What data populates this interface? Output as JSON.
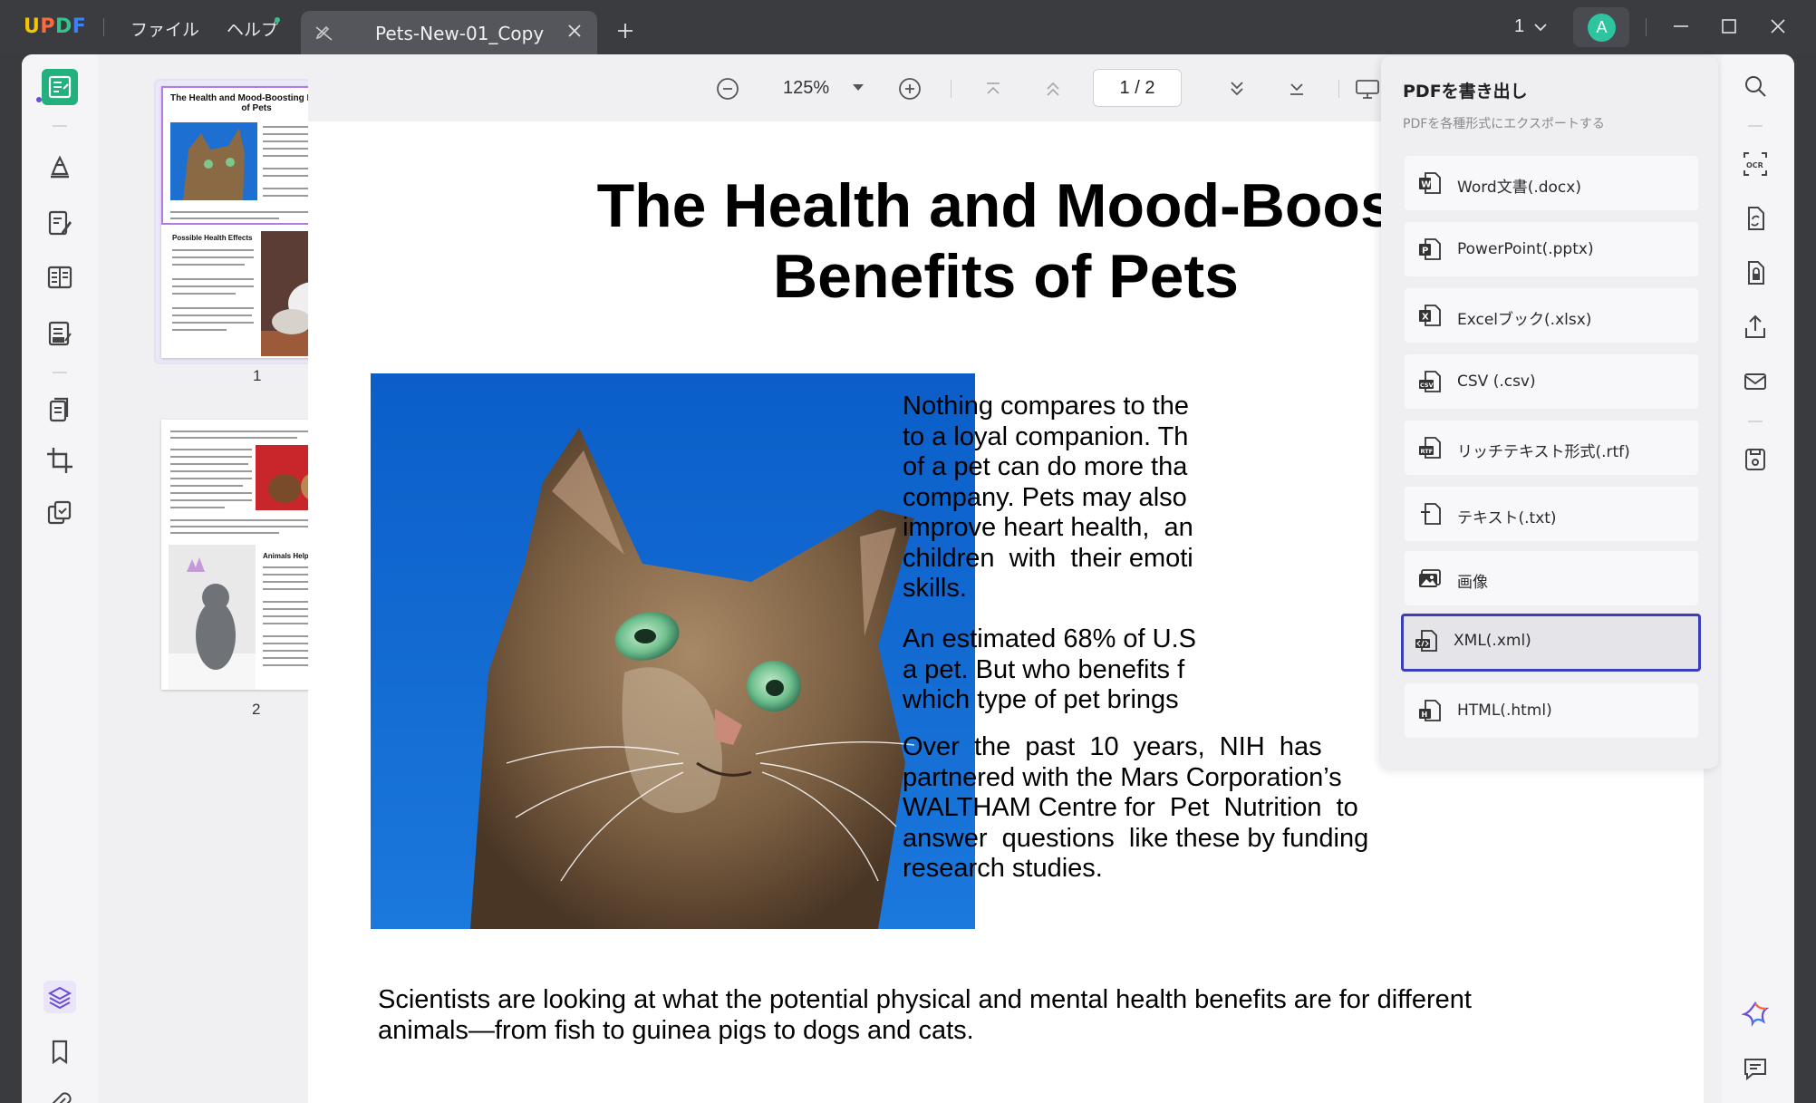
{
  "app": {
    "logo": "UPDF",
    "menus": [
      "ファイル",
      "ヘルプ"
    ],
    "tab_title": "Pets-New-01_Copy",
    "page_selector": "1",
    "avatar_letter": "A",
    "brand_colors": {
      "accent": "#22b07d",
      "selection": "#3b3dbf",
      "highlight": "#b27be8"
    }
  },
  "toolbar": {
    "zoom": "125%",
    "page_current": "1",
    "page_separator": "/",
    "page_total": "2"
  },
  "thumbnails": {
    "pages": [
      {
        "number": "1",
        "title": "The Health and Mood-Boosting Benefits of Pets",
        "heading": "Possible Health Effects"
      },
      {
        "number": "2",
        "heading": "Animals Helping People"
      }
    ]
  },
  "document": {
    "title_line1": "The Health and Mood-Boost",
    "title_line2": "Benefits of Pets",
    "para1": "Nothing compares to the\nto a loyal companion. Th\nof a pet can do more tha\ncompany. Pets may also\nimprove heart health,  an\nchildren  with  their emoti\nskills.",
    "para2": "An estimated 68% of U.S\na pet. But who benefits f\nwhich type of pet brings",
    "para3": "Over  the  past  10  years,  NIH  has\npartnered with the Mars Corporation’s\nWALTHAM Centre for  Pet  Nutrition  to\nanswer  questions  like these by funding\nresearch studies.",
    "bottom": "Scientists are looking at what the potential physical and mental health benefits are for different animals—from fish to guinea pigs to dogs and cats."
  },
  "export_panel": {
    "title": "PDFを書き出し",
    "subtitle": "PDFを各種形式にエクスポートする",
    "items": [
      {
        "label": "Word文書(.docx)",
        "icon": "word-icon"
      },
      {
        "label": "PowerPoint(.pptx)",
        "icon": "powerpoint-icon"
      },
      {
        "label": "Excelブック(.xlsx)",
        "icon": "excel-icon"
      },
      {
        "label": "CSV (.csv)",
        "icon": "csv-icon"
      },
      {
        "label": "リッチテキスト形式(.rtf)",
        "icon": "rtf-icon"
      },
      {
        "label": "テキスト(.txt)",
        "icon": "text-icon"
      },
      {
        "label": "画像",
        "icon": "image-icon"
      },
      {
        "label": "XML(.xml)",
        "icon": "xml-icon",
        "selected": true
      },
      {
        "label": "HTML(.html)",
        "icon": "html-icon"
      }
    ]
  }
}
